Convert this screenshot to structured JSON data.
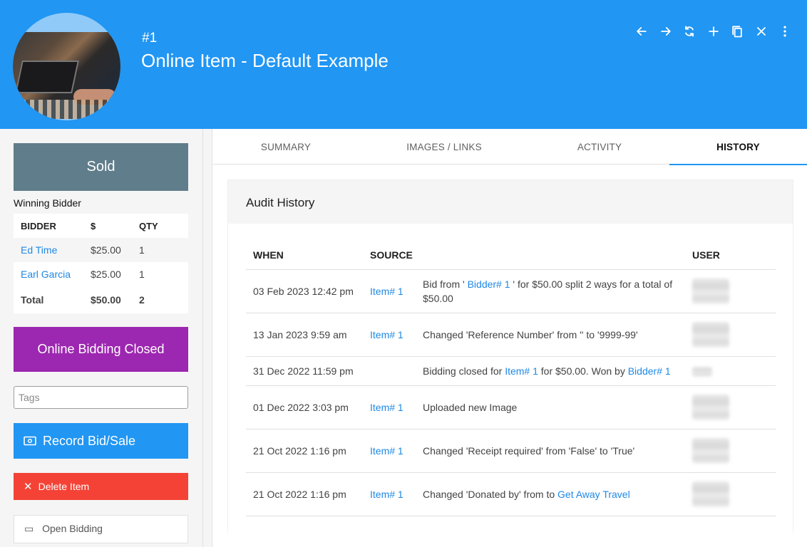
{
  "header": {
    "item_number": "#1",
    "title": "Online Item - Default Example",
    "background_color": "#2196f3",
    "icons": [
      "arrow-left-icon",
      "arrow-right-icon",
      "refresh-icon",
      "plus-icon",
      "copy-icon",
      "close-icon",
      "more-vert-icon"
    ]
  },
  "left_panel": {
    "status_label": "Sold",
    "status_color": "#607d8b",
    "winning_bidder_label": "Winning Bidder",
    "bidder_table": {
      "columns": [
        "BIDDER",
        "$",
        "QTY"
      ],
      "rows": [
        {
          "bidder": "Ed Time",
          "amount": "$25.00",
          "qty": "1"
        },
        {
          "bidder": "Earl Garcia",
          "amount": "$25.00",
          "qty": "1"
        }
      ],
      "total": {
        "label": "Total",
        "amount": "$50.00",
        "qty": "2"
      }
    },
    "bidding_status": "Online Bidding Closed",
    "bidding_status_color": "#9c27b0",
    "tags_placeholder": "Tags",
    "record_button": "Record Bid/Sale",
    "delete_button": "Delete Item",
    "open_bidding_button": "Open Bidding"
  },
  "tabs": [
    {
      "label": "SUMMARY",
      "active": false
    },
    {
      "label": "IMAGES / LINKS",
      "active": false
    },
    {
      "label": "ACTIVITY",
      "active": false
    },
    {
      "label": "HISTORY",
      "active": true
    }
  ],
  "audit": {
    "title": "Audit History",
    "columns": {
      "when": "WHEN",
      "source": "SOURCE",
      "details": "",
      "user": "USER"
    },
    "rows": [
      {
        "when": "03 Feb 2023 12:42 pm",
        "source": "Item# 1",
        "detail": [
          {
            "t": "Bid from ' "
          },
          {
            "t": "Bidder# 1",
            "link": true
          },
          {
            "t": " ' for $50.00 split 2 ways for a total of $50.00"
          }
        ]
      },
      {
        "when": "13 Jan 2023 9:59 am",
        "source": "Item# 1",
        "detail": [
          {
            "t": "Changed 'Reference Number' from '' to '9999-99'"
          }
        ]
      },
      {
        "when": "31 Dec 2022 11:59 pm",
        "source": "",
        "detail": [
          {
            "t": "Bidding closed for "
          },
          {
            "t": "Item# 1",
            "link": true
          },
          {
            "t": " for $50.00. Won by "
          },
          {
            "t": "Bidder# 1",
            "link": true
          }
        ]
      },
      {
        "when": "01 Dec 2022 3:03 pm",
        "source": "Item# 1",
        "detail": [
          {
            "t": "Uploaded new Image"
          }
        ]
      },
      {
        "when": "21 Oct 2022 1:16 pm",
        "source": "Item# 1",
        "detail": [
          {
            "t": "Changed 'Receipt required' from 'False' to 'True'"
          }
        ]
      },
      {
        "when": "21 Oct 2022 1:16 pm",
        "source": "Item# 1",
        "detail": [
          {
            "t": "Changed 'Donated by' from to "
          },
          {
            "t": "Get Away Travel",
            "link": true
          }
        ]
      }
    ]
  }
}
